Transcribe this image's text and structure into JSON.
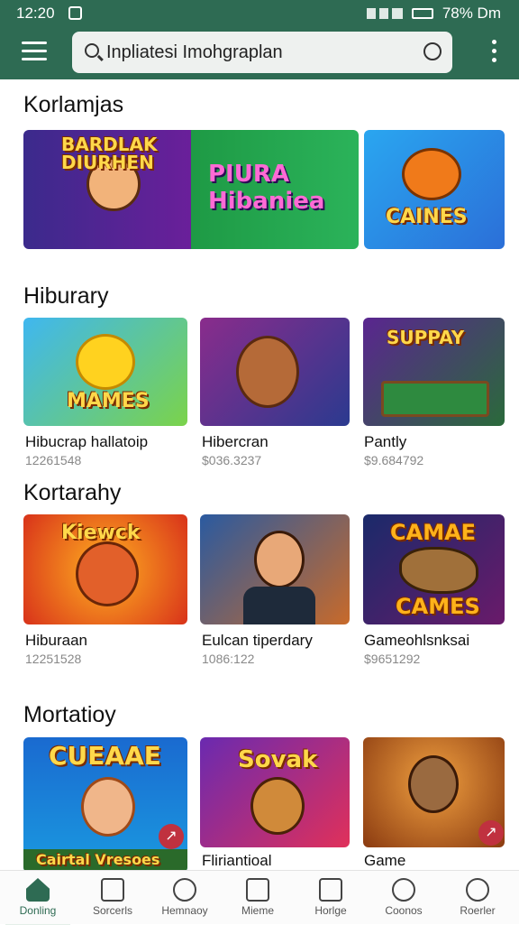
{
  "status": {
    "time": "12:20",
    "battery": "78% Dm"
  },
  "search": {
    "value": "Inpliatesi Imohgraplan"
  },
  "sections": [
    {
      "title": "Korlamjas"
    },
    {
      "title": "Hiburary"
    },
    {
      "title": "Kortarahy"
    },
    {
      "title": "Mortatioy"
    }
  ],
  "featured": [
    {
      "art": "BARDLAK DIURHEN"
    },
    {
      "art": "PIURA Hibaniea"
    },
    {
      "art": "CAINES"
    }
  ],
  "row1": [
    {
      "name": "Hibucrap hallatoip",
      "sub": "12261548",
      "art": "MAMES"
    },
    {
      "name": "Hibercran",
      "sub": "$036.3237",
      "art": ""
    },
    {
      "name": "Pantly",
      "sub": "$9.684792",
      "art": "SUPPAY"
    }
  ],
  "row2": [
    {
      "name": "Hiburaan",
      "sub": "12251528",
      "art": "Kiewck"
    },
    {
      "name": "Eulcan tiperdary",
      "sub": "1086:122",
      "art": ""
    },
    {
      "name": "Gameohlsnksai",
      "sub": "$9651292",
      "art_top": "CAMAE",
      "art_bottom": "CAMES"
    }
  ],
  "row3": [
    {
      "name": "",
      "art_top": "CUEAAE",
      "art_bottom": "Cairtal Vresoes"
    },
    {
      "name": "Fliriantioal",
      "art": "Sovak"
    },
    {
      "name": "Game",
      "art": ""
    }
  ],
  "nav": [
    {
      "label": "Donling"
    },
    {
      "label": "Sorcerls"
    },
    {
      "label": "Hemnaoy"
    },
    {
      "label": "Mieme"
    },
    {
      "label": "Horlge"
    },
    {
      "label": "Coonos"
    },
    {
      "label": "Roerler"
    }
  ],
  "colors": {
    "brand": "#2e6b53",
    "badge": "#c0313f"
  }
}
